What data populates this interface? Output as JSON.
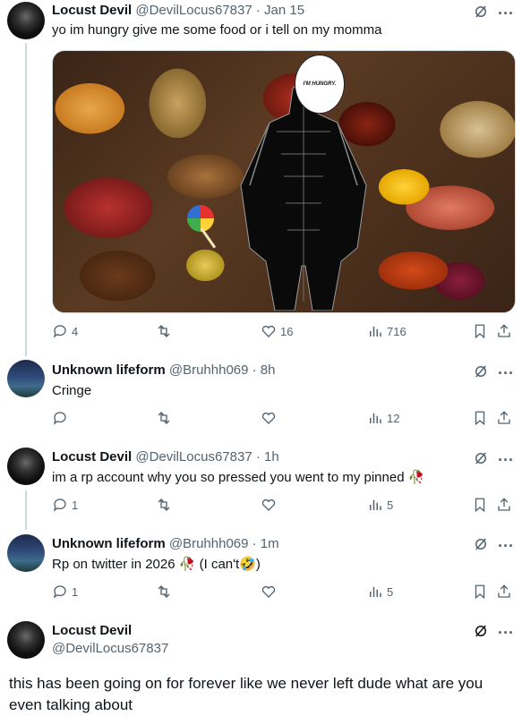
{
  "tweets": [
    {
      "name": "Locust Devil",
      "handle": "@DevilLocus67837",
      "time": "· Jan 15",
      "text": "yo im hungry give me some food or i tell on my momma",
      "replies": "4",
      "retweets": "",
      "likes": "16",
      "views": "716",
      "media_caption": "I'M HUNGRY."
    },
    {
      "name": "Unknown lifeform",
      "handle": "@Bruhhh069",
      "time": "· 8h",
      "text": "Cringe",
      "replies": "",
      "retweets": "",
      "likes": "",
      "views": "12"
    },
    {
      "name": "Locust Devil",
      "handle": "@DevilLocus67837",
      "time": "· 1h",
      "text": "im a rp account why you so pressed you went to my pinned",
      "emoji": "🥀",
      "replies": "1",
      "retweets": "",
      "likes": "",
      "views": "5"
    },
    {
      "name": "Unknown lifeform",
      "handle": "@Bruhhh069",
      "time": "· 1m",
      "text_a": "Rp on twitter in 2026",
      "emoji_a": "🥀",
      "text_b": "(I can't",
      "emoji_b": "🤣",
      "text_c": ")",
      "replies": "1",
      "retweets": "",
      "likes": "",
      "views": "5"
    },
    {
      "name": "Locust Devil",
      "handle": "@DevilLocus67837",
      "text": "this has been going on for forever like we never left dude what are you even talking about"
    }
  ],
  "icons": [
    "reply-icon",
    "retweet-icon",
    "like-icon",
    "views-icon",
    "bookmark-icon",
    "share-icon",
    "grok-icon",
    "more-icon"
  ]
}
